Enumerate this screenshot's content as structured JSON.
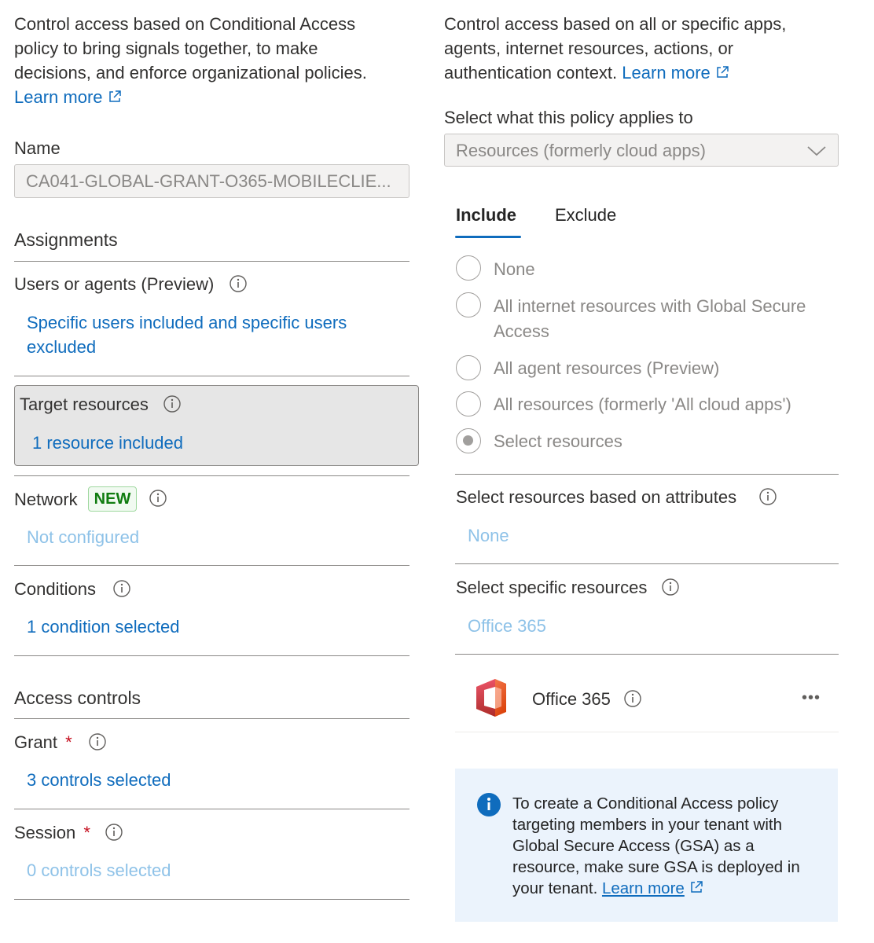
{
  "left": {
    "intro_text": "Control access based on Conditional Access policy to bring signals together, to make decisions, and enforce organizational policies.",
    "intro_line1": "Control access based on Conditional Access",
    "intro_line2": "policy to bring signals together, to make",
    "intro_line3": "decisions, and enforce organizational policies.",
    "learn_more": "Learn more",
    "name_label": "Name",
    "name_value": "CA041-GLOBAL-GRANT-O365-MOBILECLIE...",
    "assignments_heading": "Assignments",
    "users_label": "Users or agents (Preview)",
    "users_link_line1": "Specific users included and specific users",
    "users_link_line2": "excluded",
    "target_label": "Target resources",
    "target_link": "1 resource included",
    "network_label": "Network",
    "network_badge": "NEW",
    "network_value": "Not configured",
    "conditions_label": "Conditions",
    "conditions_link": "1 condition selected",
    "access_heading": "Access controls",
    "grant_label": "Grant",
    "grant_link": "3 controls selected",
    "session_label": "Session",
    "session_link": "0 controls selected",
    "required_mark": "*"
  },
  "right": {
    "intro_line1": "Control access based on all or specific apps,",
    "intro_line2": "agents, internet resources, actions, or",
    "intro_line3": "authentication context.",
    "learn_more": "Learn more",
    "applies_label": "Select what this policy applies to",
    "applies_value": "Resources (formerly cloud apps)",
    "tabs": [
      "Include",
      "Exclude"
    ],
    "radio_options": [
      "None",
      "All internet resources with Global Secure",
      "Access",
      "All agent resources (Preview)",
      "All resources (formerly 'All cloud apps')",
      "Select resources"
    ],
    "attributes_label": "Select resources based on attributes",
    "attributes_value": "None",
    "specific_label": "Select specific resources",
    "specific_value": "Office 365",
    "resource_name": "Office 365",
    "more_glyph": "•••",
    "banner_line1": "To create a Conditional Access policy",
    "banner_line2": "targeting members in your tenant with",
    "banner_line3": "Global Secure Access (GSA) as a",
    "banner_line4": "resource, make sure GSA is deployed in",
    "banner_line5": "your tenant.",
    "banner_link": "Learn more"
  },
  "colors": {
    "link": "#0f6cbd",
    "link_disabled": "#8ec2e8",
    "tab_underline": "#0f6cbd",
    "badge_text": "#107c10",
    "badge_bg": "#f1faf1",
    "banner_bg": "#ebf3fc",
    "required": "#c50f1f",
    "selected_row_bg": "#e6e6e6"
  }
}
